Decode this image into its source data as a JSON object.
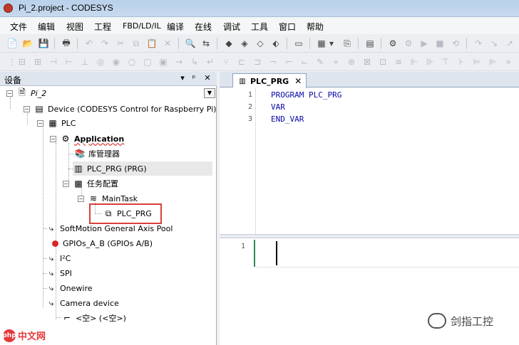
{
  "window": {
    "title": "Pi_2.project - CODESYS"
  },
  "menu": [
    "文件",
    "编辑",
    "视图",
    "工程",
    "FBD/LD/IL",
    "编译",
    "在线",
    "调试",
    "工具",
    "窗口",
    "帮助"
  ],
  "devices_panel": {
    "title": "设备",
    "pin_label": "ᵖ",
    "close_label": "✕",
    "dropdown_label": "▼"
  },
  "tree": [
    {
      "label": "Pi_2"
    },
    {
      "label": "Device (CODESYS Control for Raspberry Pi)"
    },
    {
      "label": "PLC"
    },
    {
      "label": "Application"
    },
    {
      "label": "库管理器"
    },
    {
      "label": "PLC_PRG (PRG)"
    },
    {
      "label": "任务配置"
    },
    {
      "label": "MainTask"
    },
    {
      "label": "PLC_PRG"
    },
    {
      "label": "SoftMotion General Axis Pool"
    },
    {
      "label": "GPIOs_A_B (GPIOs A/B)"
    },
    {
      "label": "I²C"
    },
    {
      "label": "SPI"
    },
    {
      "label": "Onewire"
    },
    {
      "label": "Camera device"
    },
    {
      "label": "<空> (<空>)"
    }
  ],
  "editor": {
    "tab_label": "PLC_PRG",
    "tab_close": "✕",
    "lines": [
      {
        "num": "1",
        "text": "PROGRAM PLC_PRG"
      },
      {
        "num": "2",
        "text": "VAR"
      },
      {
        "num": "3",
        "text": "END_VAR"
      }
    ],
    "impl_line": "1"
  },
  "watermark": {
    "text": "剑指工控"
  },
  "site_logo": {
    "badge": "php",
    "text": "中文网"
  }
}
